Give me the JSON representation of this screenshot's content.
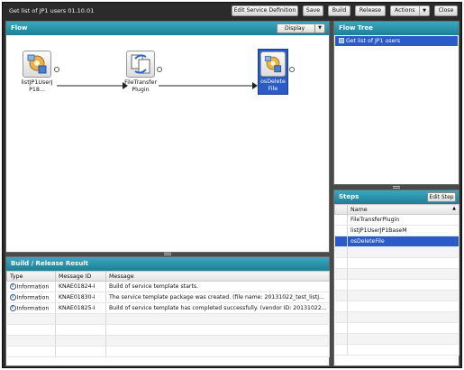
{
  "window": {
    "title": "Get list of JP1 users 01.10.01"
  },
  "toolbar": {
    "edit_service_definition": "Edit Service Definition",
    "save": "Save",
    "build": "Build",
    "release": "Release",
    "actions": "Actions",
    "close": "Close"
  },
  "flow": {
    "header": "Flow",
    "display_label": "Display",
    "nodes": [
      {
        "label": "listJP1UserJP18..."
      },
      {
        "label": "FileTransferPlugin"
      },
      {
        "label": "osDeleteFile"
      }
    ]
  },
  "flow_tree": {
    "header": "Flow Tree",
    "item": "Get list of JP1 users"
  },
  "steps": {
    "header": "Steps",
    "edit_step": "Edit Step",
    "column_name": "Name",
    "sort_indicator": "▲",
    "rows": [
      "FileTransferPlugin",
      "listJP1UserJP1BaseM",
      "osDeleteFile"
    ],
    "selected_index": 2
  },
  "build_result": {
    "header": "Build / Release Result",
    "columns": [
      "Type",
      "Message ID",
      "Message"
    ],
    "rows": [
      {
        "type": "Information",
        "id": "KNAE01824-I",
        "message": "Build of service template starts."
      },
      {
        "type": "Information",
        "id": "KNAE01830-I",
        "message": "The service template package was created. (file name: 20131022_test_listJ..."
      },
      {
        "type": "Information",
        "id": "KNAE01825-I",
        "message": "Build of service template has completed successfully. (vendor ID: 20131022..."
      }
    ]
  },
  "colors": {
    "panel_header": "#1d7f95",
    "selection": "#2a5bc8",
    "background": "#2b2b2b"
  }
}
